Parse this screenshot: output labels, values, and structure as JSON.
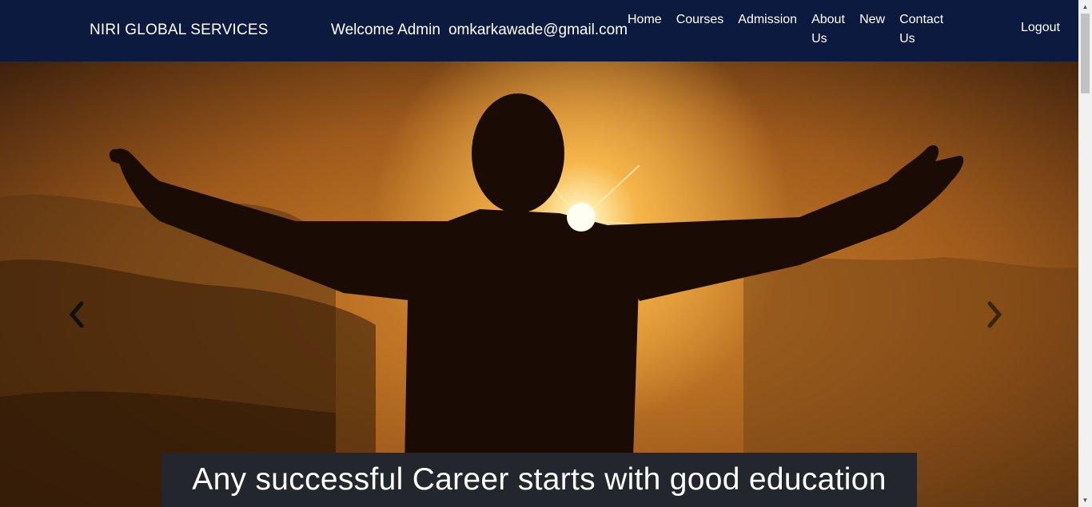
{
  "navbar": {
    "brand": "NIRI GLOBAL SERVICES",
    "welcome": "Welcome Admin",
    "email": "omkarkawade@gmail.com",
    "links": [
      {
        "label": "Home"
      },
      {
        "label": "Courses"
      },
      {
        "label": "Admission"
      },
      {
        "label": "About Us"
      },
      {
        "label": "New"
      },
      {
        "label": "Contact Us"
      }
    ],
    "logout": "Logout",
    "background": "#0c1a3f"
  },
  "carousel": {
    "caption": "Any successful Career starts with good education",
    "prev_icon": "chevron-left-icon",
    "next_icon": "chevron-right-icon"
  },
  "colors": {
    "caption_bg": "#23272d",
    "sunset_orange": "#d98a2c"
  }
}
